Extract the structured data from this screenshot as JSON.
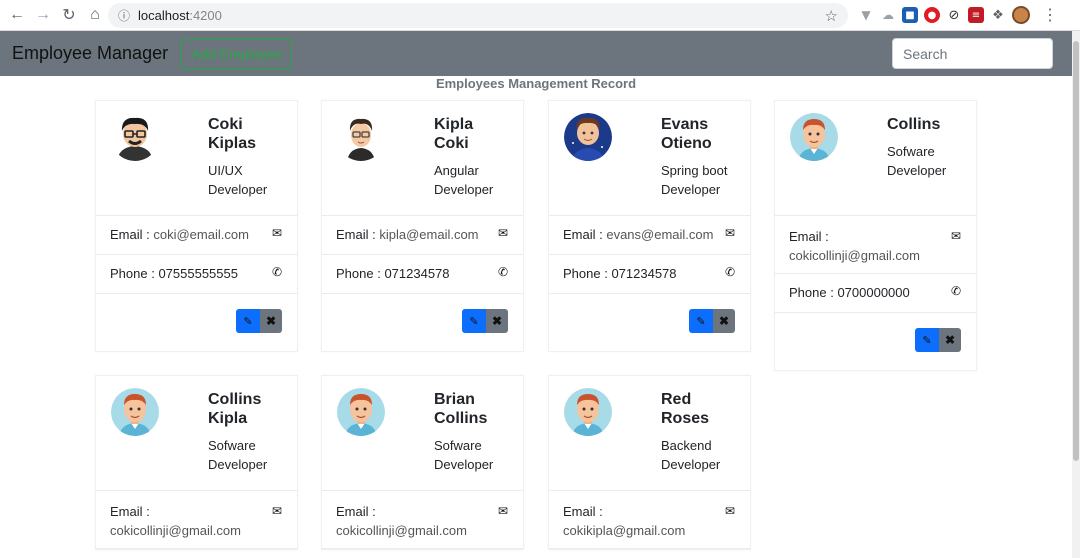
{
  "browser": {
    "url_host": "localhost",
    "url_port": ":4200"
  },
  "navbar": {
    "brand": "Employee Manager",
    "add_button": "Add Employee",
    "search_placeholder": "Search"
  },
  "heading": "Employees Management Record",
  "labels": {
    "email": "Email : ",
    "phone": "Phone : "
  },
  "employees": [
    {
      "name_line1": "Coki",
      "name_line2": "Kiplas",
      "role_line1": "UI/UX",
      "role_line2": "Developer",
      "email": "coki@email.com",
      "phone": "07555555555",
      "avatar": "man-glasses"
    },
    {
      "name_line1": "Kipla",
      "name_line2": "Coki",
      "role_line1": "Angular",
      "role_line2": "Developer",
      "email": "kipla@email.com",
      "phone": "071234578",
      "avatar": "boy-glasses"
    },
    {
      "name_line1": "Evans",
      "name_line2": "Otieno",
      "role_line1": "Spring boot",
      "role_line2": "Developer",
      "email": "evans@email.com",
      "phone": "071234578",
      "avatar": "space-avatar"
    },
    {
      "name_line1": "Collins",
      "name_line2": "",
      "role_line1": "Sofware",
      "role_line2": "Developer",
      "email": "cokicollinji@gmail.com",
      "phone": "0700000000",
      "avatar": "redhead-man"
    },
    {
      "name_line1": "Collins",
      "name_line2": "Kipla",
      "role_line1": "Sofware",
      "role_line2": "Developer",
      "email": "cokicollinji@gmail.com",
      "phone": "",
      "avatar": "redhead-man"
    },
    {
      "name_line1": "Brian",
      "name_line2": "Collins",
      "role_line1": "Sofware",
      "role_line2": "Developer",
      "email": "cokicollinji@gmail.com",
      "phone": "",
      "avatar": "redhead-man"
    },
    {
      "name_line1": "Red",
      "name_line2": "Roses",
      "role_line1": "Backend",
      "role_line2": "Developer",
      "email": "cokikipla@gmail.com",
      "phone": "",
      "avatar": "redhead-man"
    }
  ],
  "colors": {
    "navbar_bg": "#6c757d",
    "add_button": "#28a745",
    "edit_button": "#0d6efd",
    "delete_button": "#6c757d"
  }
}
